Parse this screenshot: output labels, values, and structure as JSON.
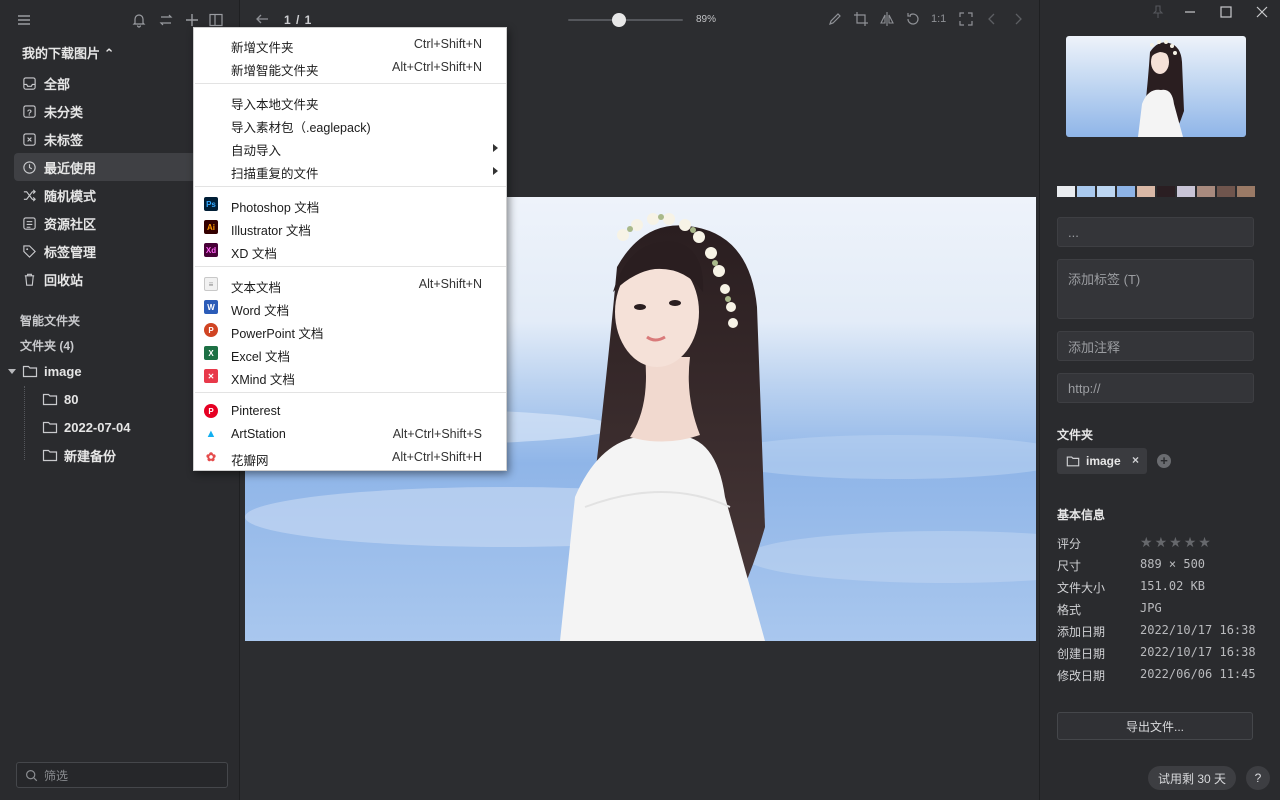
{
  "sidebar": {
    "library_title": "我的下载图片 ⌃",
    "nav": [
      {
        "label": "全部",
        "icon": "inbox-icon"
      },
      {
        "label": "未分类",
        "icon": "question-box-icon"
      },
      {
        "label": "未标签",
        "icon": "untagged-icon"
      },
      {
        "label": "最近使用",
        "icon": "clock-icon",
        "active": true
      },
      {
        "label": "随机模式",
        "icon": "shuffle-icon"
      },
      {
        "label": "资源社区",
        "icon": "community-icon"
      },
      {
        "label": "标签管理",
        "icon": "tag-icon"
      },
      {
        "label": "回收站",
        "icon": "trash-icon"
      }
    ],
    "smart_folders_title": "智能文件夹",
    "folders_title": "文件夹 (4)",
    "folders": {
      "root": "image",
      "children": [
        "80",
        "2022-07-04",
        "新建备份"
      ]
    },
    "filter_placeholder": "筛选"
  },
  "viewer": {
    "page_indicator": "1 / 1",
    "zoom": "89%",
    "zoom_level": 0.46,
    "one_to_one": "1:1"
  },
  "context_menu": {
    "groups": [
      [
        {
          "label": "新增文件夹",
          "shortcut": "Ctrl+Shift+N"
        },
        {
          "label": "新增智能文件夹",
          "shortcut": "Alt+Ctrl+Shift+N"
        }
      ],
      [
        {
          "label": "导入本地文件夹",
          "shortcut": ""
        },
        {
          "label": "导入素材包（.eaglepack)",
          "shortcut": ""
        },
        {
          "label": "自动导入",
          "shortcut": "",
          "submenu": true
        },
        {
          "label": "扫描重复的文件",
          "shortcut": "",
          "submenu": true
        }
      ],
      [
        {
          "label": "Photoshop 文档",
          "shortcut": "",
          "icon": "photoshop-icon",
          "badge": "Ps",
          "bg": "#001e36",
          "fg": "#31a8ff"
        },
        {
          "label": "Illustrator 文档",
          "shortcut": "",
          "icon": "illustrator-icon",
          "badge": "Ai",
          "bg": "#330000",
          "fg": "#ff9a00"
        },
        {
          "label": "XD 文档",
          "shortcut": "",
          "icon": "xd-icon",
          "badge": "Xd",
          "bg": "#470137",
          "fg": "#ff61f6"
        }
      ],
      [
        {
          "label": "文本文档",
          "shortcut": "Alt+Shift+N",
          "icon": "text-document-icon",
          "badge": "≡",
          "bg": "#f1f1f1",
          "fg": "#8a8a8a"
        },
        {
          "label": "Word 文档",
          "shortcut": "",
          "icon": "word-icon",
          "badge": "W",
          "bg": "#2b5cb8",
          "fg": "#ffffff"
        },
        {
          "label": "PowerPoint 文档",
          "shortcut": "",
          "icon": "powerpoint-icon",
          "badge": "P",
          "bg": "#d04423",
          "fg": "#ffffff"
        },
        {
          "label": "Excel 文档",
          "shortcut": "",
          "icon": "excel-icon",
          "badge": "X",
          "bg": "#1d7044",
          "fg": "#ffffff"
        },
        {
          "label": "XMind 文档",
          "shortcut": "",
          "icon": "xmind-icon",
          "badge": "✕",
          "bg": "#e8394a",
          "fg": "#ffffff"
        }
      ],
      [
        {
          "label": "Pinterest",
          "shortcut": "",
          "icon": "pinterest-icon",
          "badge": "P",
          "bg": "#e60023",
          "fg": "#ffffff"
        },
        {
          "label": "ArtStation",
          "shortcut": "Alt+Ctrl+Shift+S",
          "icon": "artstation-icon",
          "badge": "▲",
          "bg": "#ffffff",
          "fg": "#13aff0"
        },
        {
          "label": "花瓣网",
          "shortcut": "Alt+Ctrl+Shift+H",
          "icon": "huaban-icon",
          "badge": "✿",
          "bg": "#ffffff",
          "fg": "#e54b4b"
        }
      ]
    ]
  },
  "inspector": {
    "palette": [
      "#e9ecf0",
      "#a9c9ee",
      "#bcd6f2",
      "#8db3e6",
      "#d9b8a6",
      "#2a1e22",
      "#c8c4d6",
      "#a88a7e",
      "#6f554d",
      "#9a7a66"
    ],
    "name_field": "...",
    "tags_placeholder": "添加标签 (T)",
    "note_placeholder": "添加注释",
    "url_placeholder": "http://",
    "folder_title": "文件夹",
    "folder_chip": "image",
    "folder_chip_close": "×",
    "folder_add": "+",
    "basic_info_title": "基本信息",
    "rating_label": "评分",
    "rating_value": 0,
    "info": [
      {
        "key": "尺寸",
        "value": "889 × 500"
      },
      {
        "key": "文件大小",
        "value": "151.02 KB"
      },
      {
        "key": "格式",
        "value": "JPG"
      },
      {
        "key": "添加日期",
        "value": "2022/10/17 16:38"
      },
      {
        "key": "创建日期",
        "value": "2022/10/17 16:38"
      },
      {
        "key": "修改日期",
        "value": "2022/06/06 11:45"
      }
    ],
    "export_label": "导出文件...",
    "trial_label": "试用剩 30 天",
    "help_label": "?"
  }
}
